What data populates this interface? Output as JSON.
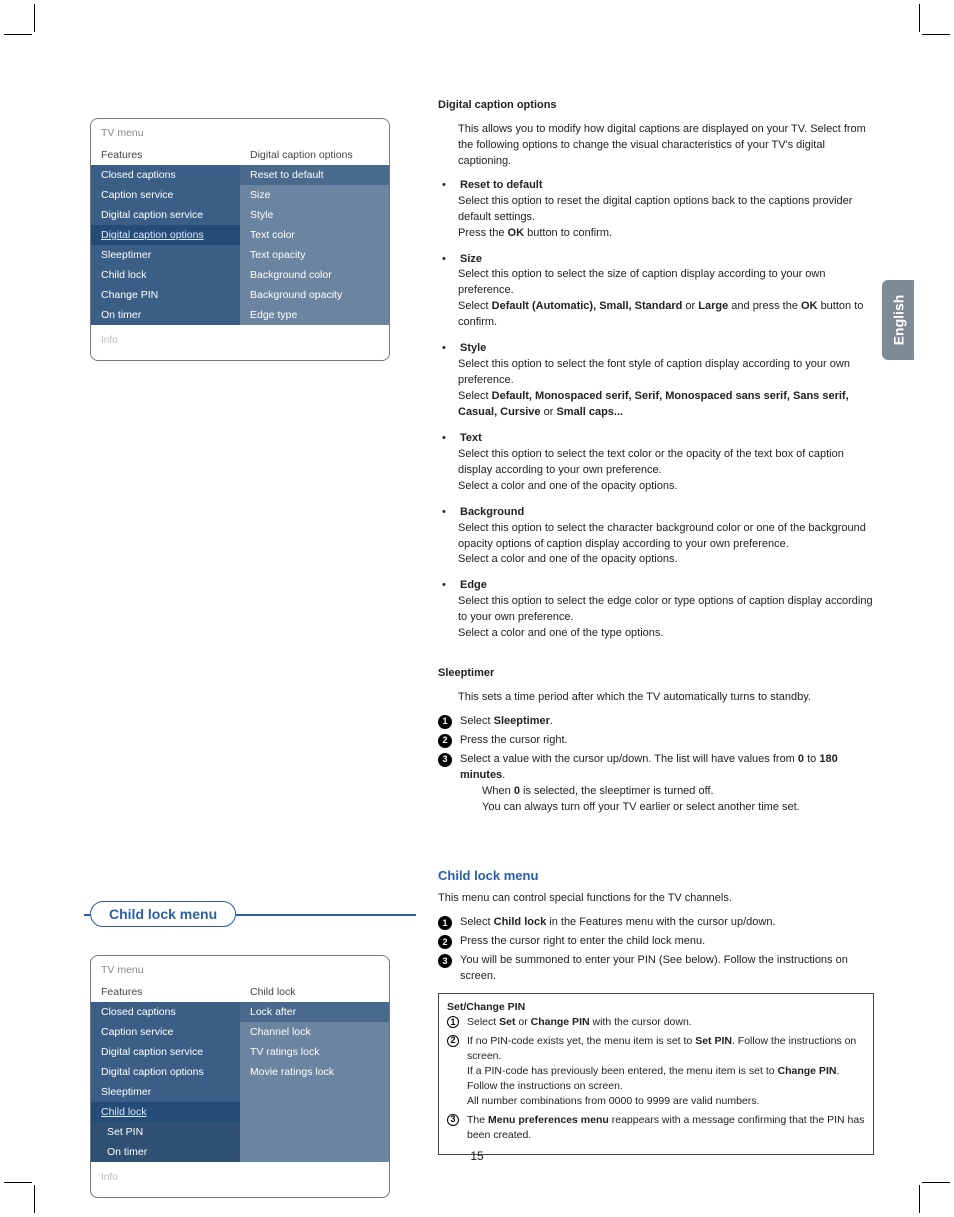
{
  "lang_tab": "English",
  "page_number": "15",
  "section_tab": "Child lock menu",
  "menu1": {
    "title": "TV menu",
    "colA_header": "Features",
    "colB_header": "Digital caption options",
    "colA": [
      "Closed captions",
      "Caption service",
      "Digital caption service",
      "Digital caption options",
      "Sleeptimer",
      "Child lock",
      "Change PIN",
      "On timer"
    ],
    "colB": [
      "Reset to default",
      "Size",
      "Style",
      "Text color",
      "Text opacity",
      "Background color",
      "Background opacity",
      "Edge type"
    ],
    "info": "Info"
  },
  "menu2": {
    "title": "TV menu",
    "colA_header": "Features",
    "colB_header": "Child lock",
    "colA": [
      "Closed captions",
      "Caption service",
      "Digital caption service",
      "Digital caption options",
      "Sleeptimer",
      "Child lock",
      "Set PIN",
      "On timer"
    ],
    "colB": [
      "Lock after",
      "Channel lock",
      "TV ratings lock",
      "Movie ratings lock"
    ],
    "info": "Info"
  },
  "r": {
    "dco": {
      "h": "Digital caption options",
      "intro": "This allows you to modify how digital captions are displayed on your TV. Select from the following options to change the visual characteristics of your TV's digital captioning.",
      "b1": {
        "t": "Reset to default",
        "p1": "Select this option to reset the digital caption options back to the captions provider default settings.",
        "p2a": "Press the",
        "ok": "OK",
        "p2b": "button to confirm."
      },
      "b2": {
        "t": "Size",
        "p1": "Select this option to select the size of caption display according to your own preference.",
        "p2a": "Select",
        "opts": "Default (Automatic), Small, Standard",
        "p2b": "or",
        "large": "Large",
        "p2c": "and press the",
        "ok": "OK",
        "p2d": "button to confirm."
      },
      "b3": {
        "t": "Style",
        "p1": "Select this option to select the font style of caption display according to your own preference.",
        "p2a": "Select",
        "opts": "Default, Monospaced serif, Serif, Monospaced sans serif, Sans serif, Casual, Cursive",
        "p2b": "or",
        "opts2": "Small caps..."
      },
      "b4": {
        "t": "Text",
        "p1": "Select this option to select the text color or the opacity of the text box of caption display according to your own preference.",
        "p2": "Select a color and one of the opacity options."
      },
      "b5": {
        "t": "Background",
        "p1": "Select this option to select the character background color or one of the background opacity options of caption display according to your own preference.",
        "p2": "Select a color and one of the opacity options."
      },
      "b6": {
        "t": "Edge",
        "p1": "Select this option to select the edge color or type options of caption display according to your own preference.",
        "p2": "Select a color and one of the type options."
      }
    },
    "sleep": {
      "h": "Sleeptimer",
      "intro": "This sets a time period after which the TV automatically turns to standby.",
      "s1a": "Select",
      "s1b": "Sleeptimer",
      "s2": "Press the cursor right.",
      "s3a": "Select a value with the cursor up/down. The list will have values from",
      "s3b": "0",
      "s3c": "to",
      "s3d": "180 minutes",
      "s3e": "When",
      "s3f": "0",
      "s3g": "is selected, the sleeptimer is turned off.",
      "s3h": "You can always turn off your TV earlier or select another time set."
    },
    "cl": {
      "h": "Child lock menu",
      "intro": "This menu can control special functions for the TV channels.",
      "s1a": "Select",
      "s1b": "Child lock",
      "s1c": "in the Features menu with the cursor up/down.",
      "s2": "Press the cursor right to enter the child lock menu.",
      "s3": "You will be summoned to enter your PIN (See below). Follow the instructions on screen."
    },
    "box": {
      "h": "Set/Change PIN",
      "s1a": "Select",
      "s1b": "Set",
      "s1c": "or",
      "s1d": "Change PIN",
      "s1e": "with the cursor down.",
      "s2a": "If no PIN-code exists yet, the menu item is set to",
      "s2b": "Set PIN",
      "s2c": "Follow the instructions on screen.",
      "s2d": "If a PIN-code has previously been entered, the menu item is set to",
      "s2e": "Change PIN",
      "s2f": "Follow the instructions on screen.",
      "s2g": "All number combinations from 0000 to 9999 are valid numbers.",
      "s3a": "The",
      "s3b": "Menu preferences menu",
      "s3c": "reappears with a message confirming that the PIN has been created."
    }
  }
}
